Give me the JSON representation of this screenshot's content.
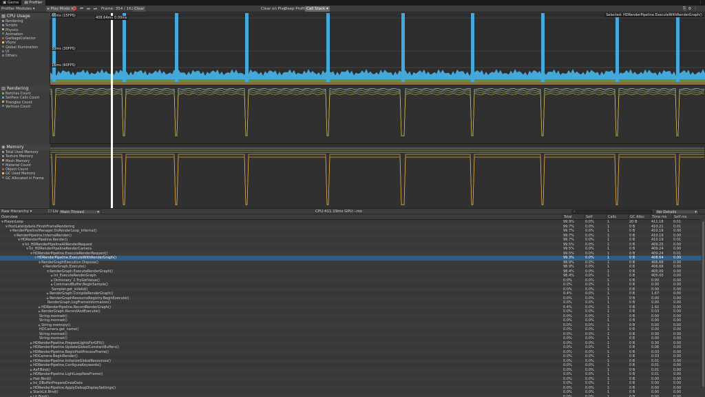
{
  "tabs": [
    {
      "label": "Game",
      "icon": "game-icon"
    },
    {
      "label": "Profiler",
      "icon": "profiler-icon"
    }
  ],
  "toolbar": {
    "modules_label": "Profiler Modules",
    "play_mode": "Play Mode",
    "frame_label": "Frame:",
    "frame_value": "354 / 1625",
    "clear": "Clear",
    "clear_on_play": "Clear on Play",
    "deep_profile": "Deep Profile",
    "call_stack": "Call Stack"
  },
  "modules": [
    {
      "title": "CPU Usage",
      "icon": "cpu-icon",
      "items": [
        {
          "label": "Rendering",
          "color": "#7cb342"
        },
        {
          "label": "Scripts",
          "color": "#4fa3d6"
        },
        {
          "label": "Physics",
          "color": "#e0a93e"
        },
        {
          "label": "Animation",
          "color": "#3a8d9e"
        },
        {
          "label": "GarbageCollector",
          "color": "#b5544b"
        },
        {
          "label": "VSync",
          "color": "#e3c44a"
        },
        {
          "label": "Global Illumination",
          "color": "#8a6c3d"
        },
        {
          "label": "UI",
          "color": "#4e7bc5"
        },
        {
          "label": "Others",
          "color": "#8a6bb8"
        }
      ]
    },
    {
      "title": "Rendering",
      "icon": "rendering-icon",
      "items": [
        {
          "label": "Batches Count",
          "color": "#7cb342"
        },
        {
          "label": "SetPass Calls Count",
          "color": "#4fa3d6"
        },
        {
          "label": "Triangles Count",
          "color": "#e0a93e"
        },
        {
          "label": "Vertices Count",
          "color": "#3a8d9e"
        }
      ]
    },
    {
      "title": "Memory",
      "icon": "memory-icon",
      "items": [
        {
          "label": "Total Used Memory",
          "color": "#7cb342"
        },
        {
          "label": "Texture Memory",
          "color": "#4fa3d6"
        },
        {
          "label": "Mesh Memory",
          "color": "#e0a93e"
        },
        {
          "label": "Material Count",
          "color": "#3a8d9e"
        },
        {
          "label": "Object Count",
          "color": "#b5544b"
        },
        {
          "label": "GC Used Memory",
          "color": "#e3c44a"
        },
        {
          "label": "GC Allocated in Frame",
          "color": "#8a6c3d"
        }
      ]
    }
  ],
  "cpu_chart": {
    "fps_labels": [
      "66ms (15FPS)",
      "33ms (30FPS)",
      "16ms (60FPS)"
    ],
    "selected_time": "408.64ms",
    "selected_time2": "0.00ms",
    "selected_label": "Selected: HDRenderPipeline.ExecuteWithRenderGraph()"
  },
  "hierarchy": {
    "view": "Raw Hierarchy",
    "live": "Live",
    "thread": "Main Thread",
    "cpu": "CPU:411.19ms",
    "gpu": "GPU:--ms",
    "details": "No Details"
  },
  "columns": [
    "Overview",
    "Total",
    "Self",
    "Calls",
    "GC Alloc",
    "Time ms",
    "Self ms"
  ],
  "rows": [
    {
      "d": 0,
      "a": "▼",
      "n": "PlayerLoop",
      "v": [
        "99.9%",
        "0.0%",
        "1",
        "20 B",
        "411.18",
        "0.01"
      ]
    },
    {
      "d": 1,
      "a": "▼",
      "n": "PostLateUpdate.FinishFrameRendering",
      "v": [
        "99.7%",
        "0.0%",
        "1",
        "0 B",
        "410.21",
        "0.01"
      ]
    },
    {
      "d": 2,
      "a": "▼",
      "n": "RenderPipelineManager.DoRenderLoop_Internal()",
      "v": [
        "99.7%",
        "0.0%",
        "1",
        "0 B",
        "410.19",
        "0.00"
      ]
    },
    {
      "d": 3,
      "a": "▼",
      "n": "RenderPipeline.InternalRender()",
      "v": [
        "99.7%",
        "0.0%",
        "1",
        "0 B",
        "410.19",
        "0.00"
      ]
    },
    {
      "d": 4,
      "a": "▼",
      "n": "HDRenderPipeline.Render()",
      "v": [
        "99.7%",
        "0.0%",
        "1",
        "0 B",
        "410.19",
        "0.01"
      ]
    },
    {
      "d": 5,
      "a": "▼",
      "n": "Inl_HDRenderPipelineAllRenderRequest",
      "v": [
        "99.5%",
        "0.0%",
        "1",
        "0 B",
        "409.25",
        "0.00"
      ]
    },
    {
      "d": 6,
      "a": "▼",
      "n": "Inl_HDRenderPipelineRenderCamera",
      "v": [
        "99.5%",
        "0.0%",
        "1",
        "0 B",
        "409.24",
        "0.00"
      ]
    },
    {
      "d": 7,
      "a": "▼",
      "n": "HDRenderPipeline.ExecuteRenderRequest()",
      "v": [
        "99.5%",
        "0.0%",
        "1",
        "0 B",
        "409.24",
        "0.01"
      ]
    },
    {
      "d": 8,
      "a": "▼",
      "n": "HDRenderPipeline.ExecuteWithRenderGraph()",
      "v": [
        "99.3%",
        "0.0%",
        "1",
        "0 B",
        "408.64",
        "0.00"
      ],
      "sel": true
    },
    {
      "d": 9,
      "a": "▼",
      "n": "RenderGraphExecution.Dispose()",
      "v": [
        "98.9%",
        "0.0%",
        "1",
        "0 B",
        "406.68",
        "0.00"
      ]
    },
    {
      "d": 10,
      "a": "▼",
      "n": "RenderGraph.Execute()",
      "v": [
        "98.9%",
        "0.0%",
        "1",
        "0 B",
        "406.68",
        "0.00"
      ]
    },
    {
      "d": 11,
      "a": "▼",
      "n": "RenderGraph.ExecuteRenderGraph()",
      "v": [
        "98.4%",
        "0.0%",
        "1",
        "0 B",
        "405.00",
        "0.00"
      ]
    },
    {
      "d": 12,
      "a": "▶",
      "n": "Inl_ExecuteRenderGraph",
      "v": [
        "98.4%",
        "0.0%",
        "1",
        "0 B",
        "405.00",
        "0.00"
      ]
    },
    {
      "d": 12,
      "a": "▶",
      "n": "Dictionary`2.TryGetValue()",
      "v": [
        "0.0%",
        "0.0%",
        "1",
        "0 B",
        "0.00",
        "0.00"
      ]
    },
    {
      "d": 12,
      "a": "▶",
      "n": "CommandBuffer.BeginSample()",
      "v": [
        "0.0%",
        "0.0%",
        "1",
        "0 B",
        "0.00",
        "0.00"
      ]
    },
    {
      "d": 12,
      "a": "",
      "n": "Sampler.get_isValid()",
      "v": [
        "0.0%",
        "0.0%",
        "1",
        "0 B",
        "0.00",
        "0.00"
      ]
    },
    {
      "d": 11,
      "a": "▶",
      "n": "RenderGraph.CompileRenderGraph()",
      "v": [
        "0.4%",
        "0.0%",
        "1",
        "0 B",
        "1.67",
        "0.00"
      ]
    },
    {
      "d": 11,
      "a": "▶",
      "n": "RenderGraphResourceRegistry.BeginExecute()",
      "v": [
        "0.0%",
        "0.0%",
        "1",
        "0 B",
        "0.00",
        "0.00"
      ]
    },
    {
      "d": 11,
      "a": "",
      "n": "RenderGraph.LogFrameInformation()",
      "v": [
        "0.0%",
        "0.0%",
        "1",
        "0 B",
        "0.00",
        "0.00"
      ]
    },
    {
      "d": 9,
      "a": "▶",
      "n": "HDRenderPipeline.RecordRenderGraph()",
      "v": [
        "0.4%",
        "0.0%",
        "1",
        "0 B",
        "1.92",
        "0.00"
      ]
    },
    {
      "d": 9,
      "a": "▶",
      "n": "RenderGraph.RecordAndExecute()",
      "v": [
        "0.0%",
        "0.0%",
        "1",
        "0 B",
        "0.03",
        "0.00"
      ]
    },
    {
      "d": 9,
      "a": "",
      "n": "String.memset()",
      "v": [
        "0.0%",
        "0.0%",
        "1",
        "0 B",
        "0.00",
        "0.00"
      ]
    },
    {
      "d": 9,
      "a": "",
      "n": "String.memset()",
      "v": [
        "0.0%",
        "0.0%",
        "1",
        "0 B",
        "0.00",
        "0.00"
      ]
    },
    {
      "d": 9,
      "a": "▶",
      "n": "String.memcpy()",
      "v": [
        "0.0%",
        "0.0%",
        "1",
        "0 B",
        "0.00",
        "0.00"
      ]
    },
    {
      "d": 9,
      "a": "",
      "n": "HDCamera.get_name()",
      "v": [
        "0.0%",
        "0.0%",
        "1",
        "0 B",
        "0.00",
        "0.00"
      ]
    },
    {
      "d": 9,
      "a": "",
      "n": "String.memset()",
      "v": [
        "0.0%",
        "0.0%",
        "1",
        "0 B",
        "0.00",
        "0.00"
      ]
    },
    {
      "d": 9,
      "a": "",
      "n": "String.memset()",
      "v": [
        "0.0%",
        "0.0%",
        "1",
        "0 B",
        "0.00",
        "0.00"
      ]
    },
    {
      "d": 7,
      "a": "▶",
      "n": "HDRenderPipeline.PrepareLightsForGPU()",
      "v": [
        "0.0%",
        "0.0%",
        "1",
        "0 B",
        "0.30",
        "0.00"
      ]
    },
    {
      "d": 7,
      "a": "▶",
      "n": "HDRenderPipeline.UpdateGlobalConstantBuffers()",
      "v": [
        "0.0%",
        "0.0%",
        "1",
        "0 B",
        "0.06",
        "0.00"
      ]
    },
    {
      "d": 7,
      "a": "▶",
      "n": "HDRenderPipeline.BeginPostProcessFrame()",
      "v": [
        "0.0%",
        "0.0%",
        "1",
        "0 B",
        "0.03",
        "0.00"
      ]
    },
    {
      "d": 7,
      "a": "▶",
      "n": "HDCamera.BeginRender()",
      "v": [
        "0.0%",
        "0.0%",
        "1",
        "0 B",
        "0.03",
        "0.00"
      ]
    },
    {
      "d": 7,
      "a": "▶",
      "n": "HDRenderPipeline.InitializeGlobalResources()",
      "v": [
        "0.0%",
        "0.0%",
        "1",
        "0 B",
        "0.01",
        "0.00"
      ]
    },
    {
      "d": 7,
      "a": "▶",
      "n": "HDRenderPipeline.ConfigureKeywords()",
      "v": [
        "0.0%",
        "0.0%",
        "1",
        "0 B",
        "0.01",
        "0.00"
      ]
    },
    {
      "d": 7,
      "a": "▶",
      "n": "AxF.Bind()",
      "v": [
        "0.0%",
        "0.0%",
        "1",
        "0 B",
        "0.01",
        "0.00"
      ]
    },
    {
      "d": 7,
      "a": "▶",
      "n": "HDRenderPipeline.LightLoopNewFrame()",
      "v": [
        "0.0%",
        "0.0%",
        "1",
        "0 B",
        "0.01",
        "0.00"
      ]
    },
    {
      "d": 7,
      "a": "▶",
      "n": "Hair.Bind()",
      "v": [
        "0.0%",
        "0.0%",
        "1",
        "0 B",
        "0.00",
        "0.00"
      ]
    },
    {
      "d": 7,
      "a": "▶",
      "n": "Inl_DBufferPrepareDrawData",
      "v": [
        "0.0%",
        "0.0%",
        "1",
        "0 B",
        "0.00",
        "0.00"
      ]
    },
    {
      "d": 7,
      "a": "▶",
      "n": "HDRenderPipeline.ApplyDebugDisplaySettings()",
      "v": [
        "0.0%",
        "0.0%",
        "1",
        "0 B",
        "0.00",
        "0.00"
      ]
    },
    {
      "d": 7,
      "a": "▶",
      "n": "StackLit.Bind()",
      "v": [
        "0.0%",
        "0.0%",
        "1",
        "0 B",
        "0.00",
        "0.00"
      ]
    },
    {
      "d": 7,
      "a": "▶",
      "n": "Lit.Bind()",
      "v": [
        "0.0%",
        "0.0%",
        "1",
        "0 B",
        "0.00",
        "0.00"
      ]
    }
  ]
}
